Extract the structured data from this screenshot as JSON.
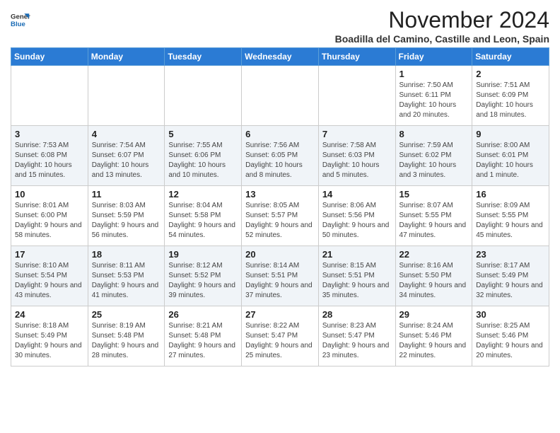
{
  "header": {
    "logo_general": "General",
    "logo_blue": "Blue",
    "month_title": "November 2024",
    "subtitle": "Boadilla del Camino, Castille and Leon, Spain"
  },
  "days_of_week": [
    "Sunday",
    "Monday",
    "Tuesday",
    "Wednesday",
    "Thursday",
    "Friday",
    "Saturday"
  ],
  "weeks": [
    {
      "days": [
        {
          "num": "",
          "info": ""
        },
        {
          "num": "",
          "info": ""
        },
        {
          "num": "",
          "info": ""
        },
        {
          "num": "",
          "info": ""
        },
        {
          "num": "",
          "info": ""
        },
        {
          "num": "1",
          "info": "Sunrise: 7:50 AM\nSunset: 6:11 PM\nDaylight: 10 hours and 20 minutes."
        },
        {
          "num": "2",
          "info": "Sunrise: 7:51 AM\nSunset: 6:09 PM\nDaylight: 10 hours and 18 minutes."
        }
      ]
    },
    {
      "days": [
        {
          "num": "3",
          "info": "Sunrise: 7:53 AM\nSunset: 6:08 PM\nDaylight: 10 hours and 15 minutes."
        },
        {
          "num": "4",
          "info": "Sunrise: 7:54 AM\nSunset: 6:07 PM\nDaylight: 10 hours and 13 minutes."
        },
        {
          "num": "5",
          "info": "Sunrise: 7:55 AM\nSunset: 6:06 PM\nDaylight: 10 hours and 10 minutes."
        },
        {
          "num": "6",
          "info": "Sunrise: 7:56 AM\nSunset: 6:05 PM\nDaylight: 10 hours and 8 minutes."
        },
        {
          "num": "7",
          "info": "Sunrise: 7:58 AM\nSunset: 6:03 PM\nDaylight: 10 hours and 5 minutes."
        },
        {
          "num": "8",
          "info": "Sunrise: 7:59 AM\nSunset: 6:02 PM\nDaylight: 10 hours and 3 minutes."
        },
        {
          "num": "9",
          "info": "Sunrise: 8:00 AM\nSunset: 6:01 PM\nDaylight: 10 hours and 1 minute."
        }
      ]
    },
    {
      "days": [
        {
          "num": "10",
          "info": "Sunrise: 8:01 AM\nSunset: 6:00 PM\nDaylight: 9 hours and 58 minutes."
        },
        {
          "num": "11",
          "info": "Sunrise: 8:03 AM\nSunset: 5:59 PM\nDaylight: 9 hours and 56 minutes."
        },
        {
          "num": "12",
          "info": "Sunrise: 8:04 AM\nSunset: 5:58 PM\nDaylight: 9 hours and 54 minutes."
        },
        {
          "num": "13",
          "info": "Sunrise: 8:05 AM\nSunset: 5:57 PM\nDaylight: 9 hours and 52 minutes."
        },
        {
          "num": "14",
          "info": "Sunrise: 8:06 AM\nSunset: 5:56 PM\nDaylight: 9 hours and 50 minutes."
        },
        {
          "num": "15",
          "info": "Sunrise: 8:07 AM\nSunset: 5:55 PM\nDaylight: 9 hours and 47 minutes."
        },
        {
          "num": "16",
          "info": "Sunrise: 8:09 AM\nSunset: 5:55 PM\nDaylight: 9 hours and 45 minutes."
        }
      ]
    },
    {
      "days": [
        {
          "num": "17",
          "info": "Sunrise: 8:10 AM\nSunset: 5:54 PM\nDaylight: 9 hours and 43 minutes."
        },
        {
          "num": "18",
          "info": "Sunrise: 8:11 AM\nSunset: 5:53 PM\nDaylight: 9 hours and 41 minutes."
        },
        {
          "num": "19",
          "info": "Sunrise: 8:12 AM\nSunset: 5:52 PM\nDaylight: 9 hours and 39 minutes."
        },
        {
          "num": "20",
          "info": "Sunrise: 8:14 AM\nSunset: 5:51 PM\nDaylight: 9 hours and 37 minutes."
        },
        {
          "num": "21",
          "info": "Sunrise: 8:15 AM\nSunset: 5:51 PM\nDaylight: 9 hours and 35 minutes."
        },
        {
          "num": "22",
          "info": "Sunrise: 8:16 AM\nSunset: 5:50 PM\nDaylight: 9 hours and 34 minutes."
        },
        {
          "num": "23",
          "info": "Sunrise: 8:17 AM\nSunset: 5:49 PM\nDaylight: 9 hours and 32 minutes."
        }
      ]
    },
    {
      "days": [
        {
          "num": "24",
          "info": "Sunrise: 8:18 AM\nSunset: 5:49 PM\nDaylight: 9 hours and 30 minutes."
        },
        {
          "num": "25",
          "info": "Sunrise: 8:19 AM\nSunset: 5:48 PM\nDaylight: 9 hours and 28 minutes."
        },
        {
          "num": "26",
          "info": "Sunrise: 8:21 AM\nSunset: 5:48 PM\nDaylight: 9 hours and 27 minutes."
        },
        {
          "num": "27",
          "info": "Sunrise: 8:22 AM\nSunset: 5:47 PM\nDaylight: 9 hours and 25 minutes."
        },
        {
          "num": "28",
          "info": "Sunrise: 8:23 AM\nSunset: 5:47 PM\nDaylight: 9 hours and 23 minutes."
        },
        {
          "num": "29",
          "info": "Sunrise: 8:24 AM\nSunset: 5:46 PM\nDaylight: 9 hours and 22 minutes."
        },
        {
          "num": "30",
          "info": "Sunrise: 8:25 AM\nSunset: 5:46 PM\nDaylight: 9 hours and 20 minutes."
        }
      ]
    }
  ]
}
